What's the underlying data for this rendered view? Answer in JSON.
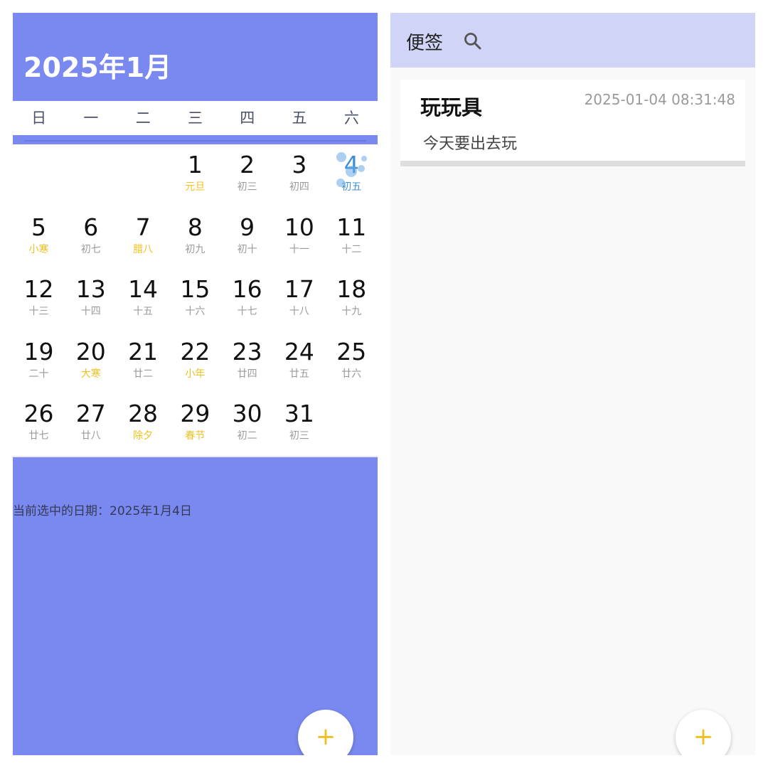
{
  "calendar": {
    "month_title": "2025年1月",
    "weekdays": [
      "日",
      "一",
      "二",
      "三",
      "四",
      "五",
      "六"
    ],
    "selected_label": "当前选中的日期：2025年1月4日",
    "fab_label": "+",
    "weeks": [
      [
        null,
        null,
        null,
        {
          "day": "1",
          "lunar": "元旦",
          "festival": true
        },
        {
          "day": "2",
          "lunar": "初三"
        },
        {
          "day": "3",
          "lunar": "初四"
        },
        {
          "day": "4",
          "lunar": "初五",
          "selected": true
        }
      ],
      [
        {
          "day": "5",
          "lunar": "小寒",
          "festival": true
        },
        {
          "day": "6",
          "lunar": "初七"
        },
        {
          "day": "7",
          "lunar": "腊八",
          "festival": true
        },
        {
          "day": "8",
          "lunar": "初九"
        },
        {
          "day": "9",
          "lunar": "初十"
        },
        {
          "day": "10",
          "lunar": "十一"
        },
        {
          "day": "11",
          "lunar": "十二"
        }
      ],
      [
        {
          "day": "12",
          "lunar": "十三"
        },
        {
          "day": "13",
          "lunar": "十四"
        },
        {
          "day": "14",
          "lunar": "十五"
        },
        {
          "day": "15",
          "lunar": "十六"
        },
        {
          "day": "16",
          "lunar": "十七"
        },
        {
          "day": "17",
          "lunar": "十八"
        },
        {
          "day": "18",
          "lunar": "十九"
        }
      ],
      [
        {
          "day": "19",
          "lunar": "二十"
        },
        {
          "day": "20",
          "lunar": "大寒",
          "festival": true
        },
        {
          "day": "21",
          "lunar": "廿二"
        },
        {
          "day": "22",
          "lunar": "小年",
          "festival": true
        },
        {
          "day": "23",
          "lunar": "廿四"
        },
        {
          "day": "24",
          "lunar": "廿五"
        },
        {
          "day": "25",
          "lunar": "廿六"
        }
      ],
      [
        {
          "day": "26",
          "lunar": "廿七"
        },
        {
          "day": "27",
          "lunar": "廿八"
        },
        {
          "day": "28",
          "lunar": "除夕",
          "festival": true
        },
        {
          "day": "29",
          "lunar": "春节",
          "festival": true
        },
        {
          "day": "30",
          "lunar": "初二"
        },
        {
          "day": "31",
          "lunar": "初三"
        },
        null
      ]
    ],
    "colors": {
      "header": "#7a89f0",
      "festival": "#f0c020",
      "selected": "#3d8fd1"
    }
  },
  "notes": {
    "title": "便签",
    "search_icon": "search-icon",
    "fab_label": "+",
    "items": [
      {
        "title": "玩玩具",
        "time": "2025-01-04 08:31:48",
        "body": "今天要出去玩"
      }
    ]
  }
}
